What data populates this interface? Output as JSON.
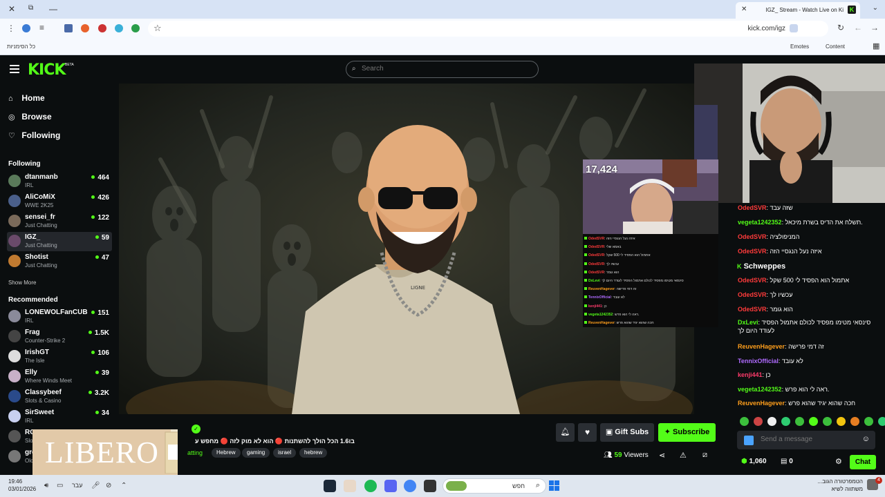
{
  "browser": {
    "tab_title": "IGZ_ Stream - Watch Live on Ki",
    "url": "kick.com/igz",
    "bookmarks_left": "כל הסימניות",
    "bookmarks_right": [
      "Emotes",
      "Content"
    ]
  },
  "kick": {
    "logo": "KICK",
    "beta": "BETA",
    "search_placeholder": "Search"
  },
  "sidebar": {
    "nav": [
      {
        "label": "Home",
        "icon": "home-icon"
      },
      {
        "label": "Browse",
        "icon": "compass-icon"
      },
      {
        "label": "Following",
        "icon": "heart-icon"
      }
    ],
    "following_title": "Following",
    "following": [
      {
        "name": "dtanmanb",
        "category": "IRL",
        "viewers": "464",
        "color": "#5a7a5a"
      },
      {
        "name": "AliCoMiX",
        "category": "WWE 2K25",
        "viewers": "426",
        "color": "#4a5f8a"
      },
      {
        "name": "sensei_fr",
        "category": "Just Chatting",
        "viewers": "122",
        "color": "#7a6a5a"
      },
      {
        "name": "IGZ_",
        "category": "Just Chatting",
        "viewers": "59",
        "color": "#6a4a6a"
      },
      {
        "name": "Shotist",
        "category": "Just Chatting",
        "viewers": "47",
        "color": "#c07a30"
      }
    ],
    "show_more": "Show More",
    "recommended_title": "Recommended",
    "recommended": [
      {
        "name": "LONEWOLFanCUB",
        "category": "IRL",
        "viewers": "151",
        "color": "#8a8a9a"
      },
      {
        "name": "Frag",
        "category": "Counter-Strike 2",
        "viewers": "1.5K",
        "color": "#444"
      },
      {
        "name": "IrishGT",
        "category": "The Isle",
        "viewers": "106",
        "color": "#ddd"
      },
      {
        "name": "Elly",
        "category": "Where Winds Meet",
        "viewers": "39",
        "color": "#c8b0c8"
      },
      {
        "name": "Classybeef",
        "category": "Slots & Casino",
        "viewers": "3.2K",
        "color": "#2a4a8a"
      },
      {
        "name": "SirSweet",
        "category": "IRL",
        "viewers": "34",
        "color": "#c8d0f0"
      },
      {
        "name": "RO",
        "category": "Slo",
        "viewers": "",
        "color": "#555"
      },
      {
        "name": "gre",
        "category": "Olo",
        "viewers": "",
        "color": "#777"
      }
    ]
  },
  "stream": {
    "viewer_counter": "17,424",
    "title": "בו1.6 הכל הולך להשתנות 🔴 הוא לא מוק לזה 🔴 מחפש ע",
    "category": "atting",
    "tags": [
      "Hebrew",
      "gaming",
      "israel",
      "hebrew"
    ],
    "viewers": "59",
    "viewers_label": "Viewers",
    "gift_label": "Gift Subs",
    "subscribe_label": "Subscribe",
    "ad_text": "LIBERO",
    "shirt_text": "LIGNE"
  },
  "mini_chat": [
    {
      "user": "OdedSVR",
      "text": "איזה נעל הנגסיי הזה",
      "color": "#ff3b3b"
    },
    {
      "user": "OdedSVR",
      "text": "באמא שלי",
      "color": "#ff3b3b"
    },
    {
      "user": "OdedSVR",
      "text": "אתמול הוא הפסיד לי 500 שקל",
      "color": "#ff3b3b"
    },
    {
      "user": "OdedSVR",
      "text": "עכשיו לך",
      "color": "#ff3b3b"
    },
    {
      "user": "OdedSVR",
      "text": "הוא גומר",
      "color": "#ff3b3b"
    },
    {
      "user": "DxLevi",
      "text": "סינסאי מטימו מפסיד לכולם אתמול הפסיד לעודד היום לך",
      "color": "#53fc18"
    },
    {
      "user": "ReuvenHagever",
      "text": "זה דמי פרישה",
      "color": "#ff9f1c"
    },
    {
      "user": "TennixOfficial",
      "text": "לא עובד",
      "color": "#b06bff"
    },
    {
      "user": "kenji441",
      "text": "כן",
      "color": "#ff3b6b"
    },
    {
      "user": "vegeta1242352",
      "text": "ראה לי הוא פרש.",
      "color": "#53fc18"
    },
    {
      "user": "ReuvenHagever",
      "text": "חכה שהוא יגיד שהוא פרש",
      "color": "#ff9f1c"
    }
  ],
  "chat": {
    "overlay_name": "Schweppes",
    "messages": [
      {
        "user": "OdedSVR",
        "text": "שזה עבד",
        "color": "#ff3b3b"
      },
      {
        "user": "vegeta1242352",
        "text": "תשלח את הדיס בשרת מיכאל.",
        "color": "#53fc18"
      },
      {
        "user": "OdedSVR",
        "text": "המניפולציה",
        "color": "#ff3b3b"
      },
      {
        "user": "OdedSVR",
        "text": "איזה נעל הנגסיי הזה",
        "color": "#ff3b3b"
      },
      {
        "user": "",
        "text": "",
        "color": "#fff"
      },
      {
        "user": "OdedSVR",
        "text": "אתמול הוא הפסיד לי 500 שקל",
        "color": "#ff3b3b"
      },
      {
        "user": "OdedSVR",
        "text": "עכשיו לך",
        "color": "#ff3b3b"
      },
      {
        "user": "OdedSVR",
        "text": "הוא גומר",
        "color": "#ff3b3b"
      },
      {
        "user": "DxLevi",
        "text": "סינסאי מטימו מפסיד לכולם אתמול הפסיד לעודד היום לך",
        "color": "#53fc18"
      },
      {
        "user": "ReuvenHagever",
        "text": "זה דמי פרישה",
        "color": "#ff9f1c"
      },
      {
        "user": "TennixOfficial",
        "text": "לא עובד",
        "color": "#b06bff"
      },
      {
        "user": "kenji441",
        "text": "כן",
        "color": "#ff3b6b"
      },
      {
        "user": "vegeta1242352",
        "text": "ראה לי הוא פרש.",
        "color": "#53fc18"
      },
      {
        "user": "ReuvenHagever",
        "text": "חכה שהוא יגיד שהוא פרש",
        "color": "#ff9f1c"
      }
    ],
    "send_placeholder": "Send a message",
    "points": "1,060",
    "points2": "0",
    "chat_button": "Chat"
  },
  "taskbar": {
    "time": "19:46",
    "date": "03/01/2026",
    "lang": "עבר",
    "search_text": "חפש",
    "weather_line1": "הטמפרטורה הגוב...",
    "weather_line2": "משתווה לשיא",
    "weather_badge": "4"
  },
  "colors": {
    "kick_green": "#53fc18",
    "background": "#0b0e0f",
    "panel": "#24272c"
  }
}
